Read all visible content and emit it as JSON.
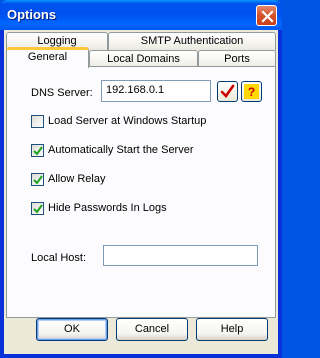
{
  "window": {
    "title": "Options"
  },
  "tabs": {
    "logging": "Logging",
    "smtp_auth": "SMTP Authentication",
    "general": "General",
    "local_domains": "Local Domains",
    "ports": "Ports"
  },
  "general": {
    "dns_label": "DNS Server:",
    "dns_value": "192.168.0.1",
    "options": [
      {
        "label": "Load Server at Windows Startup",
        "checked": false
      },
      {
        "label": "Automatically Start the Server",
        "checked": true
      },
      {
        "label": "Allow Relay",
        "checked": true
      },
      {
        "label": "Hide Passwords In Logs",
        "checked": true
      }
    ],
    "local_host_label": "Local Host:",
    "local_host_value": ""
  },
  "buttons": {
    "ok": "OK",
    "cancel": "Cancel",
    "help": "Help"
  },
  "icons": {
    "check_button": "checkmark-icon",
    "help_button": "question-icon",
    "close": "close-icon"
  },
  "colors": {
    "title_bar": "#0054e3",
    "dialog_bg": "#ece9d8",
    "active_tab_accent": "#ffc83c",
    "check_mark": "#21a121",
    "help_bg": "#ffd800"
  }
}
